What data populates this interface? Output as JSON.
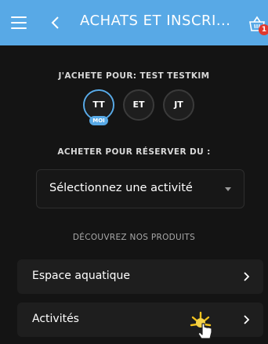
{
  "header": {
    "title": "ACHATS ET INSCRI...",
    "menu_icon": "hamburger-icon",
    "back_icon": "chevron-left-icon",
    "cart_icon": "basket-icon",
    "cart_badge": "1",
    "background": "#58a9e6"
  },
  "buyer": {
    "label": "J'ACHETE POUR: TEST TESTKIM",
    "members": [
      {
        "initials": "TT",
        "tag": "MOI",
        "selected": true
      },
      {
        "initials": "ET",
        "selected": false
      },
      {
        "initials": "JT",
        "selected": false
      }
    ]
  },
  "reserve": {
    "label": "ACHETER POUR RÉSERVER DU :",
    "select_value": "Sélectionnez une activité"
  },
  "products": {
    "heading": "DÉCOUVREZ NOS PRODUITS",
    "items": [
      {
        "label": "Espace aquatique"
      },
      {
        "label": "Activités"
      }
    ]
  },
  "colors": {
    "accent": "#58a9e6",
    "background": "#141414",
    "card": "#1e1e1e",
    "badge": "#e0392e"
  }
}
